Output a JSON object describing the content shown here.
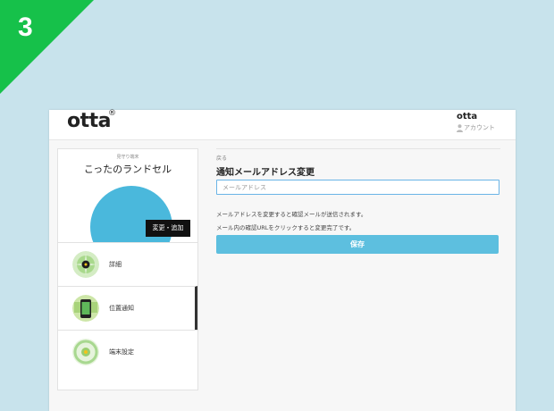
{
  "step": {
    "number": "3",
    "color": "#16c14a"
  },
  "header": {
    "logo": "otta",
    "logo_mark": "®",
    "user_name": "otta",
    "account_label": "アカウント",
    "account_icon": "person-icon"
  },
  "device": {
    "caption": "見守り端末",
    "name": "こったのランドセル",
    "change_button": "変更・追加",
    "image_color": "#4ab8dc"
  },
  "menu": {
    "items": [
      {
        "label": "詳細",
        "icon": "details-icon",
        "active": false
      },
      {
        "label": "位置通知",
        "icon": "phone-icon",
        "active": true
      },
      {
        "label": "端末設定",
        "icon": "settings-icon",
        "active": false
      }
    ]
  },
  "form": {
    "back_link": "戻る",
    "title": "通知メールアドレス変更",
    "email_placeholder": "メールアドレス",
    "note1": "メールアドレスを変更すると確認メールが送信されます。",
    "note2": "メール内の確認URLをクリックすると変更完了です。",
    "save_label": "保存",
    "save_color": "#5dbfdf"
  }
}
